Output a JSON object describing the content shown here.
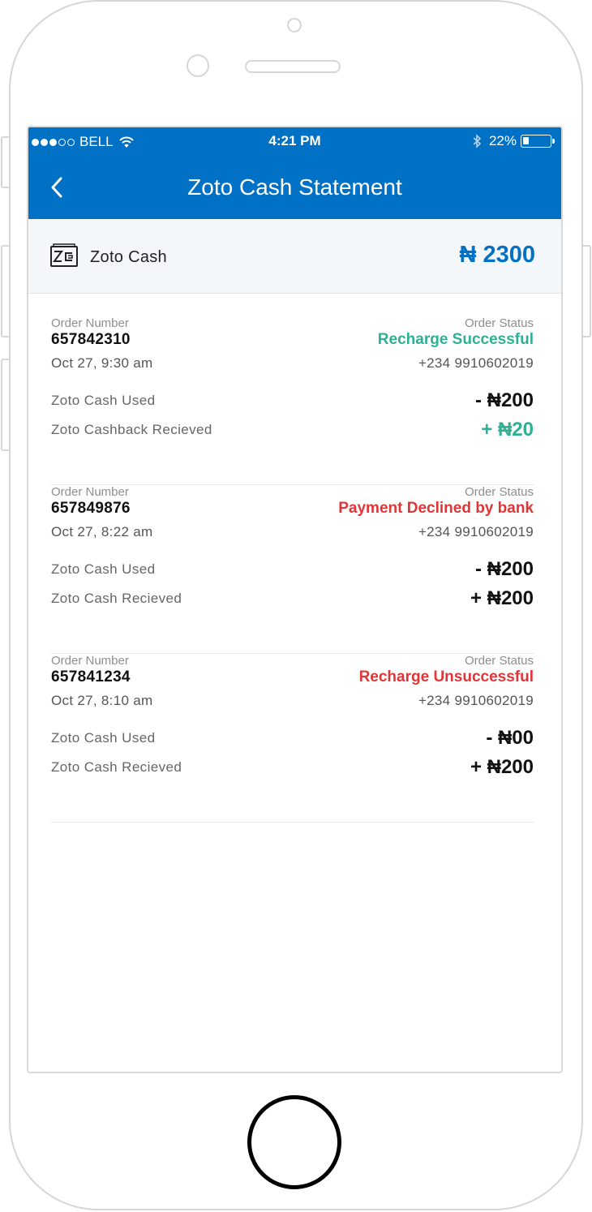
{
  "status_bar": {
    "carrier": "BELL",
    "time": "4:21 PM",
    "battery": "22%",
    "battery_level": 0.22
  },
  "header": {
    "title": "Zoto Cash Statement"
  },
  "balance": {
    "label": "Zoto Cash",
    "amount": "₦ 2300"
  },
  "orders": [
    {
      "number_label": "Order Number",
      "status_label": "Order Status",
      "number": "657842310",
      "status": "Recharge Successful",
      "status_color": "#2fb094",
      "date": "Oct 27, 9:30 am",
      "phone": "+234 9910602019",
      "row1_label": "Zoto Cash Used",
      "row1_amount": "- ₦200",
      "row2_label": "Zoto Cashback Recieved",
      "row2_amount": "+ ₦20"
    },
    {
      "number_label": "Order Number",
      "status_label": "Order Status",
      "number": "657849876",
      "status": "Payment Declined by bank",
      "status_color": "#e03638",
      "date": "Oct 27, 8:22 am",
      "phone": "+234 9910602019",
      "row1_label": "Zoto Cash Used",
      "row1_amount": "- ₦200",
      "row2_label": "Zoto Cash Recieved",
      "row2_amount": "+ ₦200"
    },
    {
      "number_label": "Order Number",
      "status_label": "Order Status",
      "number": "657841234",
      "status": "Recharge Unsuccessful",
      "status_color": "#e03638",
      "date": "Oct 27, 8:10 am",
      "phone": "+234 9910602019",
      "row1_label": "Zoto Cash Used",
      "row1_amount": "- ₦00",
      "row2_label": "Zoto Cash Recieved",
      "row2_amount": "+ ₦200"
    }
  ],
  "colors": {
    "brand": "#0071c5",
    "success": "#2fb094",
    "error": "#e03638"
  },
  "icons": [
    "signal-dots-icon",
    "wifi-icon",
    "bluetooth-icon",
    "battery-icon",
    "back-chevron-icon",
    "zoto-cash-wallet-icon"
  ]
}
